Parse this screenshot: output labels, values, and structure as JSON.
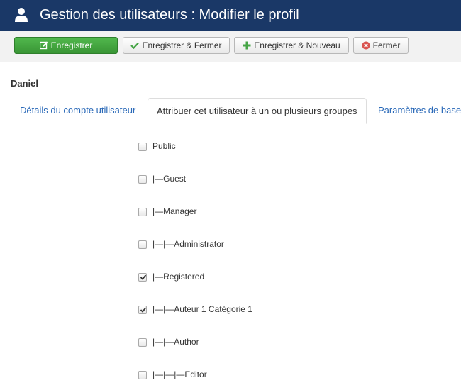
{
  "header": {
    "title": "Gestion des utilisateurs : Modifier le profil",
    "icon": "user-icon",
    "background": "#1a3867"
  },
  "toolbar": {
    "save_label": "Enregistrer",
    "save_close_label": "Enregistrer & Fermer",
    "save_new_label": "Enregistrer & Nouveau",
    "close_label": "Fermer",
    "colors": {
      "success": "#46a546",
      "check_green": "#46a546",
      "close_red": "#d9534f"
    }
  },
  "user": {
    "name": "Daniel"
  },
  "tabs": [
    {
      "label": "Détails du compte utilisateur",
      "active": false
    },
    {
      "label": "Attribuer cet utilisateur à un ou plusieurs groupes",
      "active": true
    },
    {
      "label": "Paramètres de base",
      "active": false
    }
  ],
  "groups": [
    {
      "label": "Public",
      "checked": false
    },
    {
      "label": "|—Guest",
      "checked": false
    },
    {
      "label": "|—Manager",
      "checked": false
    },
    {
      "label": "|—|—Administrator",
      "checked": false
    },
    {
      "label": "|—Registered",
      "checked": true
    },
    {
      "label": "|—|—Auteur 1 Catégorie 1",
      "checked": true
    },
    {
      "label": "|—|—Author",
      "checked": false
    },
    {
      "label": "|—|—|—Editor",
      "checked": false
    }
  ]
}
